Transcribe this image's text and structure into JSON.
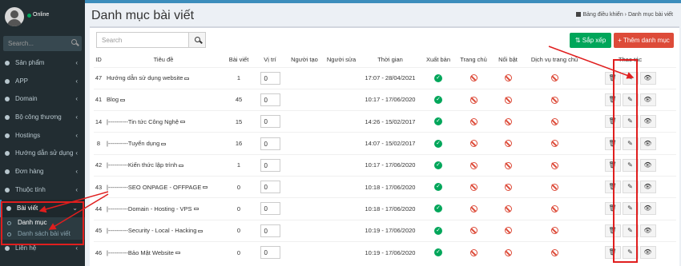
{
  "sidebar": {
    "status": "Online",
    "search_placeholder": "Search...",
    "items": [
      {
        "label": "Sản phẩm",
        "chevron": "‹"
      },
      {
        "label": "APP",
        "chevron": "‹"
      },
      {
        "label": "Domain",
        "chevron": "‹"
      },
      {
        "label": "Bộ công thương",
        "chevron": "‹"
      },
      {
        "label": "Hostings",
        "chevron": "‹"
      },
      {
        "label": "Hướng dẫn sử dụng",
        "chevron": "‹"
      },
      {
        "label": "Đơn hàng",
        "chevron": "‹"
      },
      {
        "label": "Thuộc tính",
        "chevron": "‹"
      },
      {
        "label": "Bài viết",
        "chevron": "⌄"
      }
    ],
    "subitems": [
      "Danh mục",
      "Danh sách bài viết"
    ],
    "last_item": {
      "label": "Liên hệ",
      "chevron": "‹"
    }
  },
  "header": {
    "title": "Danh mục bài viết",
    "breadcrumb_home": "Bảng điều khiển",
    "breadcrumb_sep": "›",
    "breadcrumb_current": "Danh mục bài viết"
  },
  "toolbar": {
    "search_placeholder": "Search",
    "sort_label": "Sắp xếp",
    "add_label": "+ Thêm danh mục"
  },
  "table": {
    "headers": [
      "ID",
      "Tiêu đề",
      "Bài viết",
      "Vị trí",
      "Người tạo",
      "Người sửa",
      "Thời gian",
      "Xuất bản",
      "Trang chủ",
      "Nổi bật",
      "Dịch vụ trang chủ",
      "Thao tác"
    ],
    "rows": [
      {
        "id": "47",
        "title": "Hướng dẫn sử dụng website",
        "posts": "1",
        "pos": "0",
        "time": "17:07 - 28/04/2021"
      },
      {
        "id": "41",
        "title": "Blog",
        "posts": "45",
        "pos": "0",
        "time": "10:17 - 17/06/2020"
      },
      {
        "id": "14",
        "title": "|----------Tin tức Công Nghệ",
        "posts": "15",
        "pos": "0",
        "time": "14:26 - 15/02/2017"
      },
      {
        "id": "8",
        "title": "|----------Tuyển dụng",
        "posts": "16",
        "pos": "0",
        "time": "14:07 - 15/02/2017"
      },
      {
        "id": "42",
        "title": "|----------Kiến thức lập trình",
        "posts": "1",
        "pos": "0",
        "time": "10:17 - 17/06/2020"
      },
      {
        "id": "43",
        "title": "|----------SEO ONPAGE - OFFPAGE",
        "posts": "0",
        "pos": "0",
        "time": "10:18 - 17/06/2020"
      },
      {
        "id": "44",
        "title": "|----------Domain - Hosting - VPS",
        "posts": "0",
        "pos": "0",
        "time": "10:18 - 17/06/2020"
      },
      {
        "id": "45",
        "title": "|----------Security - Local - Hacking",
        "posts": "0",
        "pos": "0",
        "time": "10:19 - 17/06/2020"
      },
      {
        "id": "46",
        "title": "|----------Bảo Mật Website",
        "posts": "0",
        "pos": "0",
        "time": "10:19 - 17/06/2020"
      }
    ]
  },
  "icons": {
    "check": "✓",
    "delete": "🗑",
    "edit": "✎",
    "view": "👁"
  },
  "colors": {
    "accent": "#3c8dbc",
    "success": "#00a65a",
    "danger": "#dd4b39",
    "annotation": "#e01e1e"
  }
}
